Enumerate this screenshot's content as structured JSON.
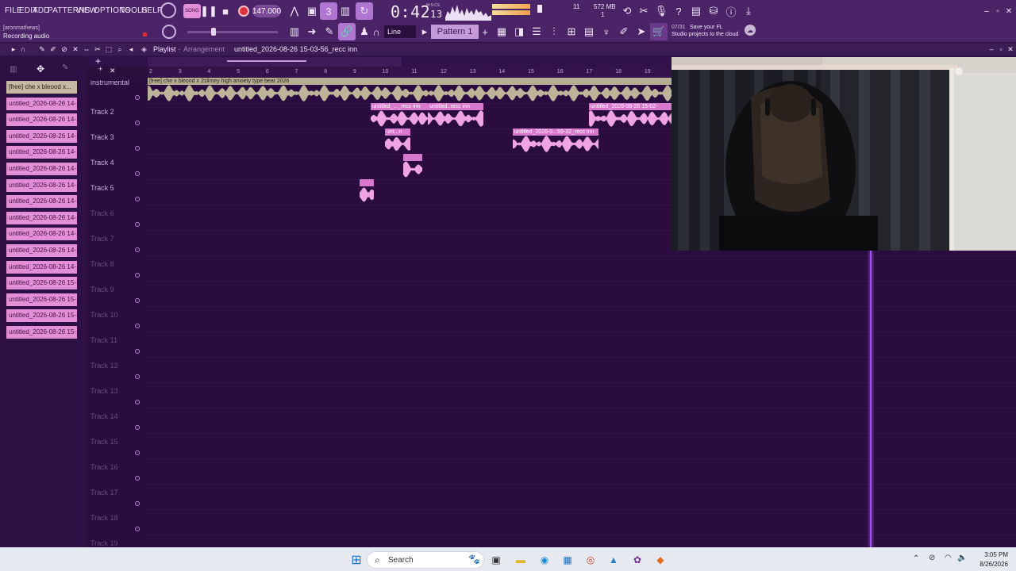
{
  "menu": [
    "FILE",
    "EDIT",
    "ADD",
    "PATTERNS",
    "VIEW",
    "OPTIONS",
    "TOOLS",
    "HELP"
  ],
  "transport": {
    "mode_label": "SONG",
    "tempo": "147.000",
    "time_main": "0:42",
    "time_sub": "13",
    "time_unit": "M:S:CS",
    "cpu_value": "11",
    "ram_value": "572 MB",
    "poly_value": "1"
  },
  "hint": {
    "user": "[aronmathews]",
    "status": "Recording audio"
  },
  "toolbar": {
    "snap_label": "Line",
    "pattern_label": "Pattern 1"
  },
  "cloud": {
    "counter": "07/31",
    "line1": "Save your FL",
    "line2": "Studio projects to the cloud"
  },
  "playlist": {
    "title": "Playlist",
    "mode": "Arrangement",
    "arrangement_name": "untitled_2026-08-26 15-03-56_recc inn",
    "ruler_marks": [
      "2",
      "3",
      "4",
      "5",
      "6",
      "7",
      "8",
      "9",
      "10",
      "11",
      "12",
      "13",
      "14",
      "15",
      "16",
      "17",
      "18",
      "19"
    ],
    "tracks": [
      {
        "name": "instrumental",
        "active": true
      },
      {
        "name": "Track 2",
        "active": true
      },
      {
        "name": "Track 3",
        "active": true
      },
      {
        "name": "Track 4",
        "active": true
      },
      {
        "name": "Track 5",
        "active": true
      },
      {
        "name": "Track 6",
        "active": false
      },
      {
        "name": "Track 7",
        "active": false
      },
      {
        "name": "Track 8",
        "active": false
      },
      {
        "name": "Track 9",
        "active": false
      },
      {
        "name": "Track 10",
        "active": false
      },
      {
        "name": "Track 11",
        "active": false
      },
      {
        "name": "Track 12",
        "active": false
      },
      {
        "name": "Track 13",
        "active": false
      },
      {
        "name": "Track 14",
        "active": false
      },
      {
        "name": "Track 15",
        "active": false
      },
      {
        "name": "Track 16",
        "active": false
      },
      {
        "name": "Track 17",
        "active": false
      },
      {
        "name": "Track 18",
        "active": false
      },
      {
        "name": "Track 19",
        "active": false
      }
    ],
    "clips": {
      "instrumental": "[free] che x bleood x 2slimey high anxiety type beat 2026",
      "t2a": "untitled_..._recc inn",
      "t2b": "untitled..recc inn",
      "t2c": "untitled_2026-08-26 15-02-",
      "t3a": "unt...n",
      "t3b": "untitled_2026-0...59-32_recc inn"
    }
  },
  "picker": {
    "items": [
      "[free] che x bleood x...",
      "untitled_2026-08-26 14-...",
      "untitled_2026-08-26 14-...",
      "untitled_2026-08-26 14-...",
      "untitled_2026-08-26 14-...",
      "untitled_2026-08-26 14-...",
      "untitled_2026-08-26 14-...",
      "untitled_2026-08-26 14-...",
      "untitled_2026-08-26 14-...",
      "untitled_2026-08-26 14-...",
      "untitled_2026-08-26 14-...",
      "untitled_2026-08-26 14-...",
      "untitled_2026-08-26 15-...",
      "untitled_2026-08-26 15-...",
      "untitled_2026-08-26 15-...",
      "untitled_2026-08-26 15-..."
    ]
  },
  "taskbar": {
    "search_placeholder": "Search",
    "time": "3:05 PM",
    "date": "8/26/2026"
  },
  "colors": {
    "accent": "#e38fd8",
    "bg": "#2b0c40",
    "toolbar": "#4a2466",
    "playhead": "#a64bff"
  }
}
